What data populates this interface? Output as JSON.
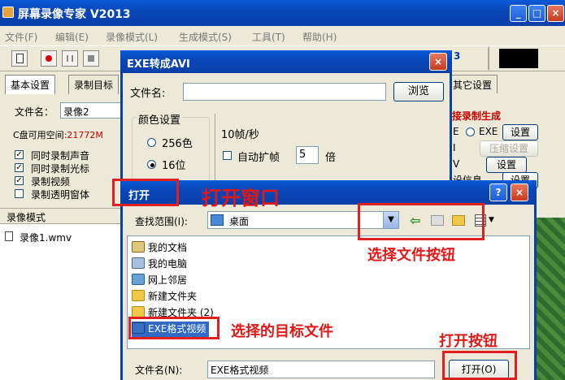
{
  "main_window": {
    "title": "屏幕录像专家 V2013",
    "controls": {
      "minimize": "_",
      "maximize": "□",
      "close": "×"
    },
    "menu": [
      "文件(F)",
      "编辑(E)",
      "录像模式(L)",
      "生成模式(S)",
      "工具(T)",
      "帮助(H)"
    ],
    "toolbar_number": "3",
    "tabs": [
      "基本设置",
      "录制目标"
    ],
    "right_tab": "其它设置",
    "filename_label": "文件名：",
    "filename_value": "录像2",
    "disk_label": "C盘可用空间",
    "disk_value": ":21772M",
    "checks": [
      {
        "label": "同时录制声音",
        "checked": true
      },
      {
        "label": "同时录制光标",
        "checked": true
      },
      {
        "label": "录制视频",
        "checked": true
      },
      {
        "label": "录制透明窗体",
        "checked": false
      }
    ],
    "mode_header": "录像模式",
    "record_item": "录像1.wmv",
    "right_panel": {
      "heading": "接录制生成",
      "exe_radio": "EXE",
      "set1": "设置",
      "compress": "压缩设置",
      "set2": "设置",
      "set3": "设置",
      "cut_text": "设信息",
      "r1": "E",
      "r2": "I",
      "r3": "V"
    }
  },
  "exe_dialog": {
    "title": "EXE转成AVI",
    "filename_label": "文件名:",
    "browse": "浏览",
    "color_group": "颜色设置",
    "color_options": [
      {
        "label": "256色",
        "selected": false
      },
      {
        "label": "16位",
        "selected": true
      }
    ],
    "fps": "10帧/秒",
    "auto_frame": "自动扩帧",
    "auto_value": "5",
    "times": "倍"
  },
  "open_dialog": {
    "title": "打开",
    "help": "?",
    "close": "×",
    "look_in_label": "查找范围(I):",
    "look_in_value": "桌面",
    "items": [
      {
        "label": "我的文档",
        "icon": "documents-icon"
      },
      {
        "label": "我的电脑",
        "icon": "computer-icon"
      },
      {
        "label": "网上邻居",
        "icon": "network-icon"
      },
      {
        "label": "新建文件夹",
        "icon": "folder-icon"
      },
      {
        "label": "新建文件夹 (2)",
        "icon": "folder-icon"
      },
      {
        "label": "EXE格式视频",
        "icon": "video-file-icon"
      }
    ],
    "filename_label": "文件名(N):",
    "filename_value": "EXE格式视频",
    "open_button": "打开(O)"
  },
  "annotations": {
    "open_window": "打开窗口",
    "select_button": "选择文件按钮",
    "target_file": "选择的目标文件",
    "open_button": "打开按钮"
  },
  "colors": {
    "annotation_red": "#e01818",
    "title_blue": "#0a3fa8",
    "disk_red": "#cc0000"
  }
}
